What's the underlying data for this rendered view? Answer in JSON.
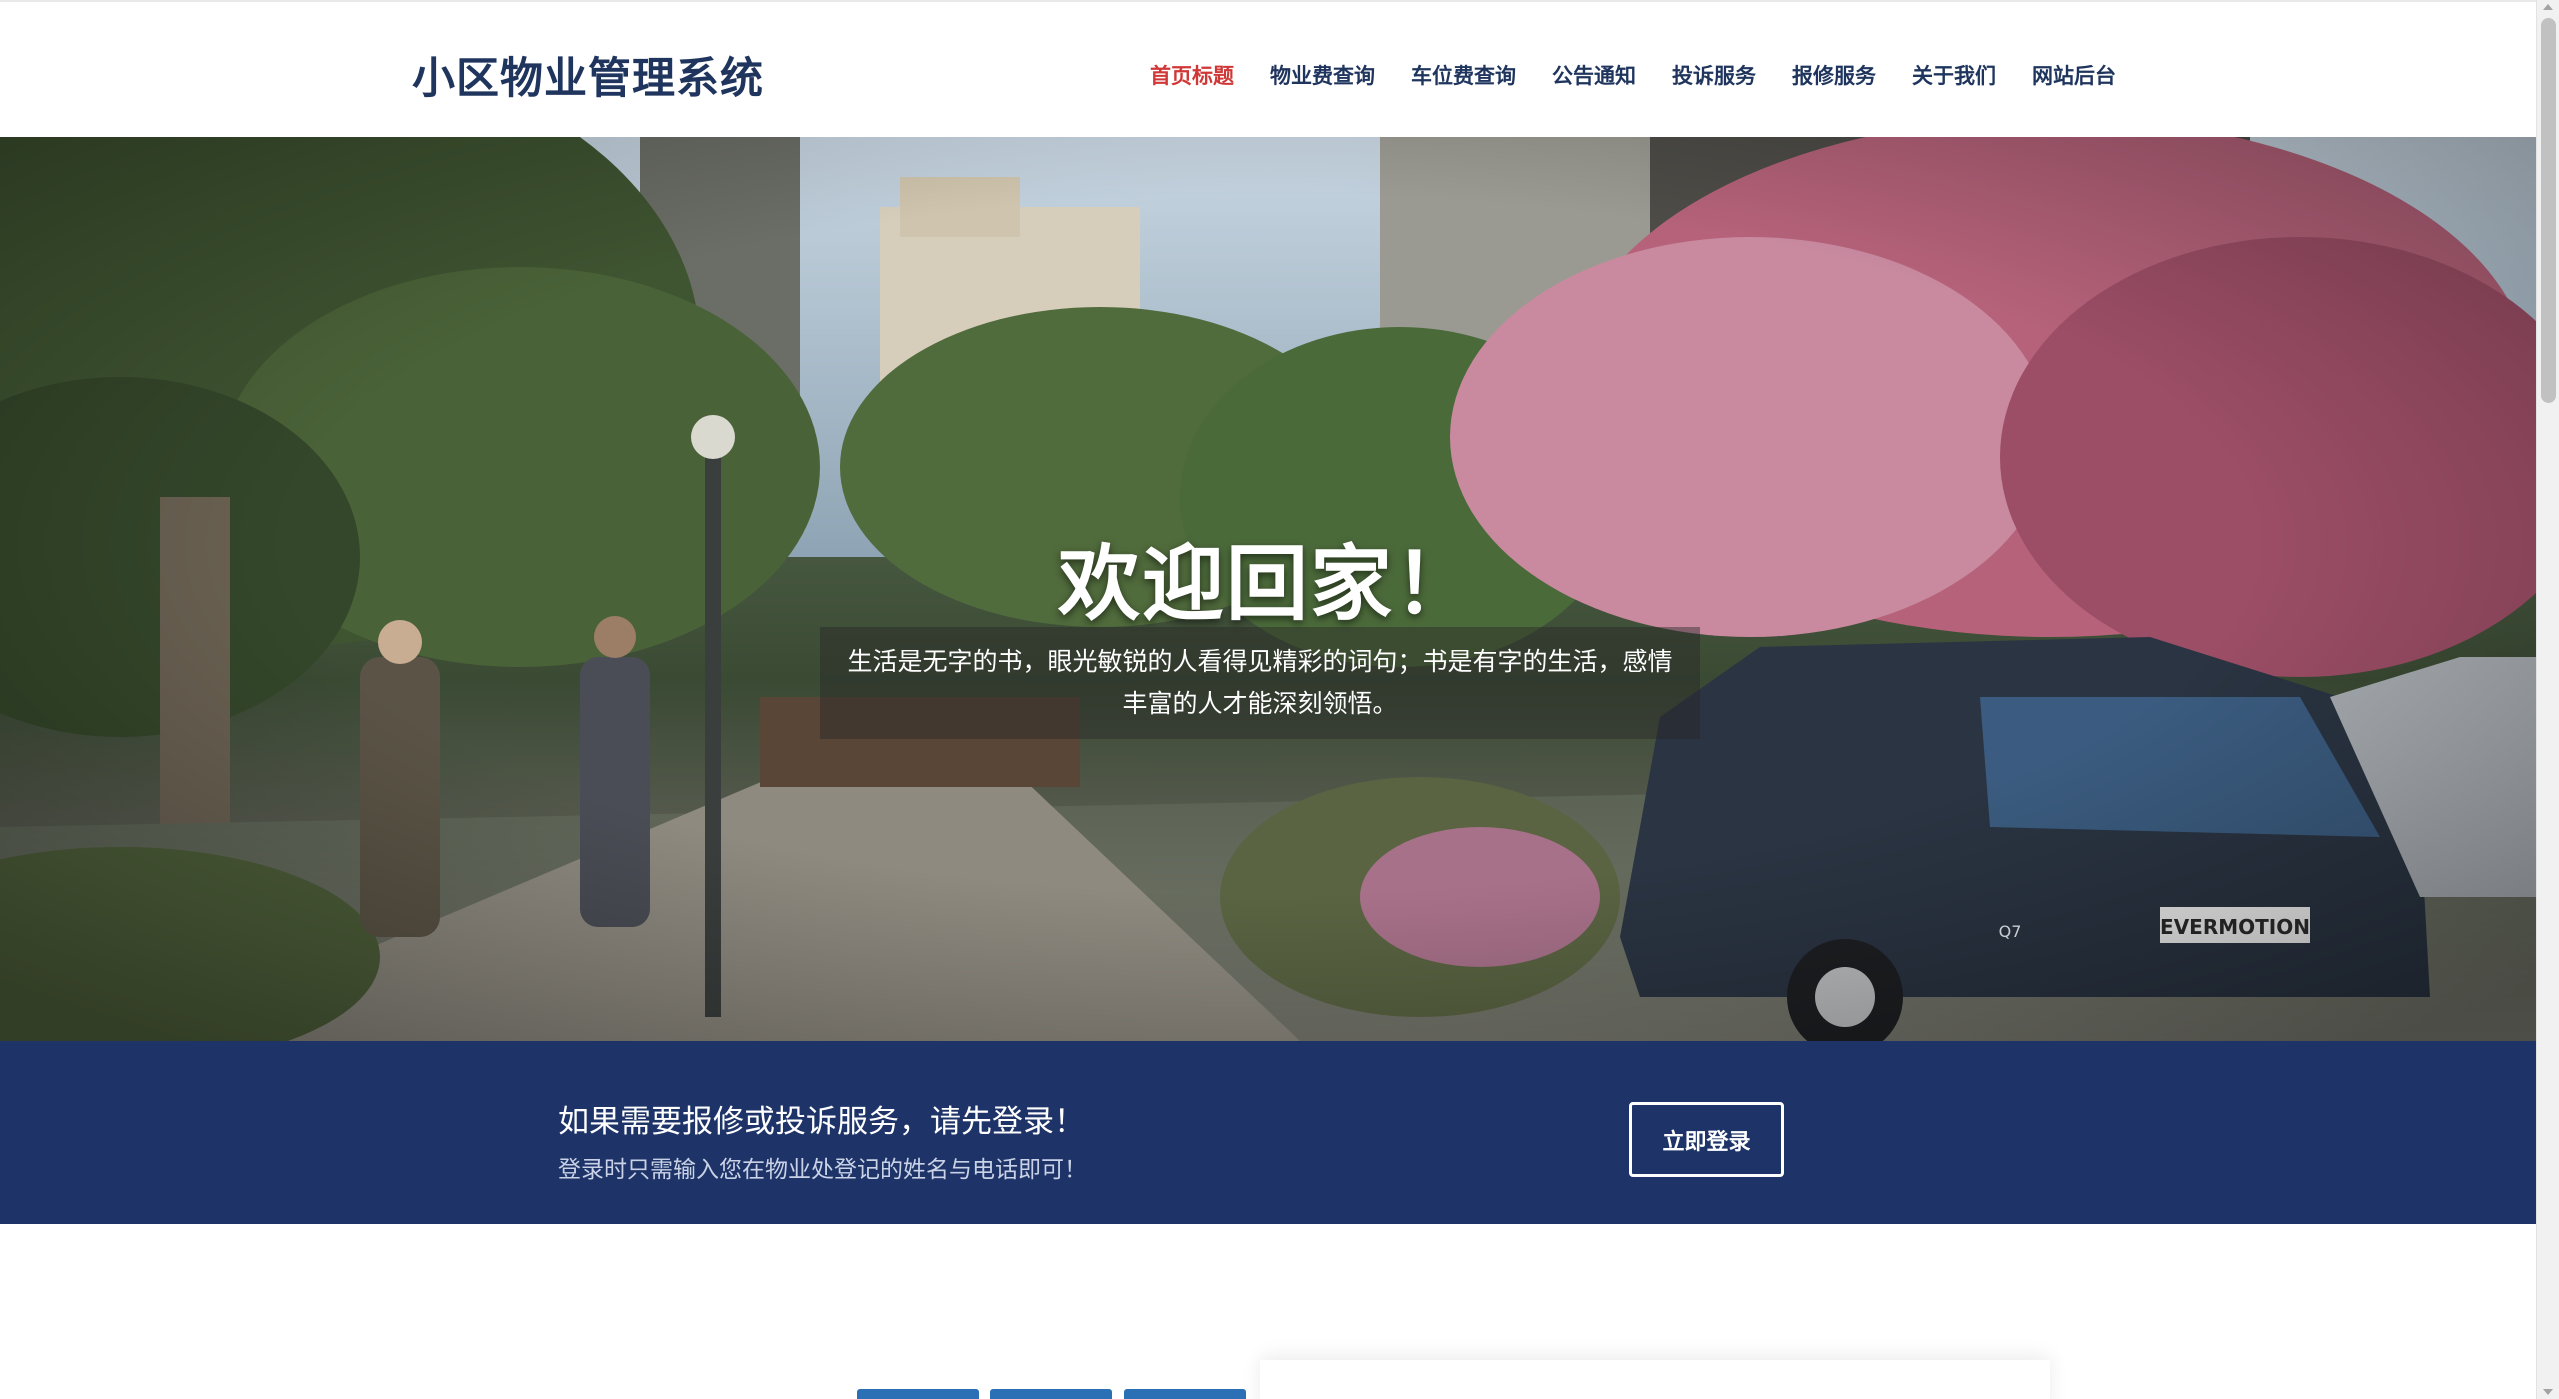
{
  "brand": {
    "title": "小区物业管理系统"
  },
  "nav": {
    "items": [
      {
        "label": "首页标题",
        "active": true
      },
      {
        "label": "物业费查询"
      },
      {
        "label": "车位费查询"
      },
      {
        "label": "公告通知"
      },
      {
        "label": "投诉服务"
      },
      {
        "label": "报修服务"
      },
      {
        "label": "关于我们"
      },
      {
        "label": "网站后台"
      }
    ]
  },
  "hero": {
    "title": "欢迎回家！",
    "quote": "生活是无字的书，眼光敏锐的人看得见精彩的词句；书是有字的生活，感情丰富的人才能深刻领悟。",
    "car_plate": "EVERMOTION",
    "car_badge": "Q7"
  },
  "login_band": {
    "title": "如果需要报修或投诉服务，请先登录！",
    "subtitle": "登录时只需输入您在物业处登记的姓名与电话即可！",
    "button_label": "立即登录"
  },
  "colors": {
    "brand_navy": "#1f355e",
    "nav_active": "#d03838",
    "band_bg": "#1e3468",
    "tab_blue": "#2b6fb5"
  }
}
